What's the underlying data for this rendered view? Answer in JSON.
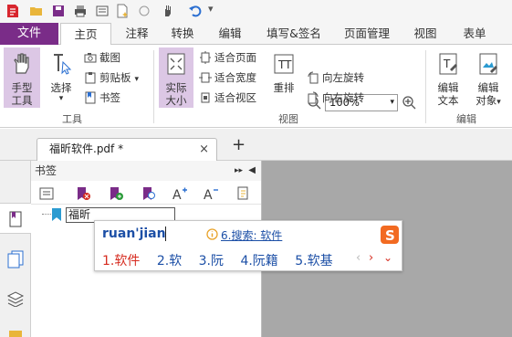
{
  "ribbon_tabs": {
    "file": "文件",
    "items": [
      "主页",
      "注释",
      "转换",
      "编辑",
      "填写&签名",
      "页面管理",
      "视图",
      "表单"
    ]
  },
  "tools_group": {
    "hand_tool": "手型\n工具",
    "hand_l1": "手型",
    "hand_l2": "工具",
    "select": "选择",
    "screenshot": "截图",
    "clipboard": "剪贴板",
    "bookmark": "书签",
    "label": "工具"
  },
  "view_group": {
    "actual_l1": "实际",
    "actual_l2": "大小",
    "fit_page": "适合页面",
    "fit_width": "适合宽度",
    "fit_view": "适合视区",
    "reflow": "重排",
    "zoom_value": "100%",
    "rotate_left": "向左旋转",
    "rotate_right": "向右旋转",
    "label": "视图"
  },
  "edit_group": {
    "edit_text_l1": "编辑",
    "edit_text_l2": "文本",
    "edit_obj_l1": "编辑",
    "edit_obj_l2": "对象",
    "label": "编辑"
  },
  "document_tab": {
    "title": "福昕软件.pdf *",
    "close": "×",
    "new_tab": "+"
  },
  "bookmark_panel": {
    "title": "书签",
    "entry_text": "福昕"
  },
  "ime": {
    "pinyin": "ruan'jian",
    "search": "6.搜索: 软件",
    "candidates": [
      "1.软件",
      "2.软",
      "3.阮",
      "4.阮籍",
      "5.软基"
    ]
  },
  "colors": {
    "file_tab": "#7a2c88",
    "active_button": "#dcc7e5",
    "ime_blue": "#1c4fa6",
    "ime_red": "#d62b1f",
    "doc_area": "#a8a8a8"
  }
}
